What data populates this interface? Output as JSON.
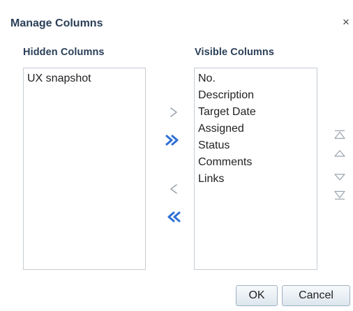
{
  "dialog": {
    "title": "Manage Columns",
    "close_label": "×"
  },
  "hidden_columns": {
    "heading": "Hidden Columns",
    "items": [
      "UX snapshot"
    ]
  },
  "visible_columns": {
    "heading": "Visible Columns",
    "items": [
      "No.",
      "Description",
      "Target Date",
      "Assigned",
      "Status",
      "Comments",
      "Links"
    ]
  },
  "shuttle_buttons": [
    {
      "name": "move-selected-right-icon",
      "state": "disabled"
    },
    {
      "name": "move-all-right-icon",
      "state": "enabled"
    },
    {
      "name": "move-selected-left-icon",
      "state": "disabled"
    },
    {
      "name": "move-all-left-icon",
      "state": "enabled"
    }
  ],
  "reorder_buttons": [
    {
      "name": "move-to-top-icon"
    },
    {
      "name": "move-up-icon"
    },
    {
      "name": "move-down-icon"
    },
    {
      "name": "move-to-bottom-icon"
    }
  ],
  "footer": {
    "ok_label": "OK",
    "cancel_label": "Cancel"
  },
  "colors": {
    "heading": "#2a3f58",
    "accent_arrow": "#2e6fd6",
    "disabled_arrow": "#9aa3ad",
    "border": "#c5ccd4"
  }
}
